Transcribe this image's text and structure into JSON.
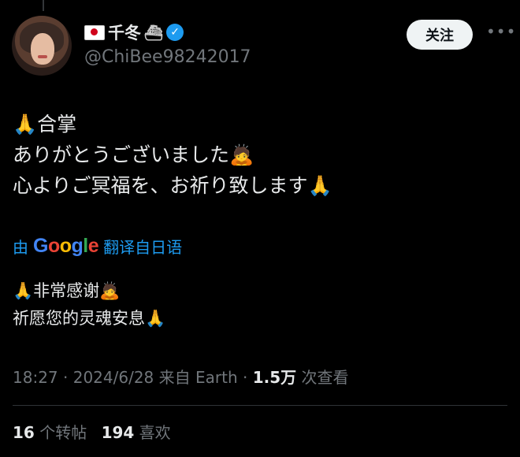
{
  "author": {
    "display_name": "千冬",
    "handle": "@ChiBee98242017",
    "flag_icon": "japan-flag-icon",
    "ship_icon": "ship-icon",
    "verified_icon": "verified-badge-icon"
  },
  "actions": {
    "follow_label": "关注",
    "more_label": "•••"
  },
  "tweet": {
    "original_lines": [
      "🙏合掌",
      "ありがとうございました🙇",
      "心よりご冥福を、お祈り致します🙏"
    ],
    "translate_prefix": "由",
    "translate_suffix": "翻译自日语",
    "translated_lines": [
      "🙏非常感谢🙇",
      "祈愿您的灵魂安息🙏"
    ]
  },
  "meta": {
    "time": "18:27",
    "date": "2024/6/28",
    "source": "来自 Earth",
    "views_count": "1.5万",
    "views_label": "次查看"
  },
  "stats": {
    "reposts_count": "16",
    "reposts_label": "个转帖",
    "likes_count": "194",
    "likes_label": "喜欢"
  },
  "colors": {
    "background": "#000000",
    "text": "#e7e9ea",
    "muted": "#71767b",
    "accent": "#1d9bf0"
  }
}
